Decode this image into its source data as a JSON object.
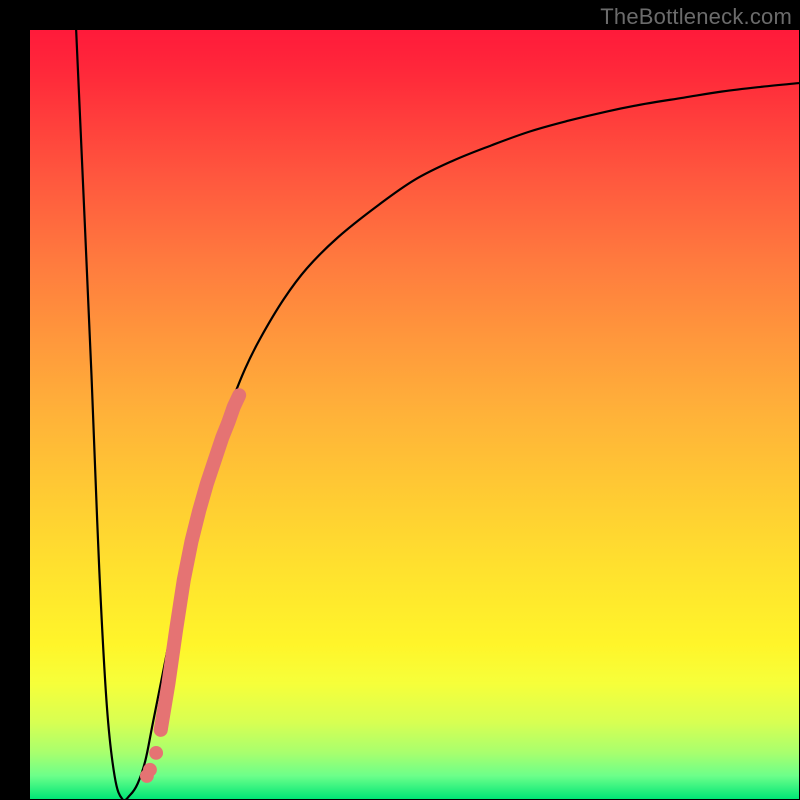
{
  "watermark": "TheBottleneck.com",
  "colors": {
    "background": "#000000",
    "curve": "#000000",
    "dots": "#e57373",
    "gradient_top": "#ff1a3a",
    "gradient_bottom": "#00e676"
  },
  "chart_data": {
    "type": "line",
    "title": "",
    "xlabel": "",
    "ylabel": "",
    "xlim": [
      0,
      100
    ],
    "ylim": [
      0,
      100
    ],
    "grid": false,
    "legend": null,
    "series": [
      {
        "name": "curve",
        "x": [
          6,
          8,
          9,
          10,
          11,
          12,
          13,
          14,
          15,
          16,
          18,
          20,
          22,
          24,
          26,
          28,
          30,
          33,
          36,
          40,
          45,
          50,
          55,
          60,
          65,
          70,
          75,
          80,
          85,
          90,
          95,
          100
        ],
        "y": [
          100,
          55,
          30,
          12,
          3,
          0,
          0.5,
          2,
          5,
          10,
          20,
          30,
          38,
          45,
          51,
          56,
          60,
          65,
          69,
          73,
          77,
          80.5,
          83,
          85,
          86.8,
          88.2,
          89.4,
          90.4,
          91.2,
          92,
          92.6,
          93.1
        ]
      }
    ],
    "annotations": {
      "dot_cluster": {
        "x": [
          15.2,
          15.6,
          16.4,
          17.0,
          18.0,
          19.0,
          20.0,
          21.0,
          22.0,
          23.0,
          24.0,
          25.0,
          25.8,
          26.5,
          27.2
        ],
        "y": [
          3.0,
          3.8,
          6.0,
          9.0,
          15.0,
          22.0,
          28.5,
          33.5,
          37.5,
          41.0,
          44.0,
          47.0,
          49.0,
          51.0,
          52.5
        ]
      }
    }
  }
}
